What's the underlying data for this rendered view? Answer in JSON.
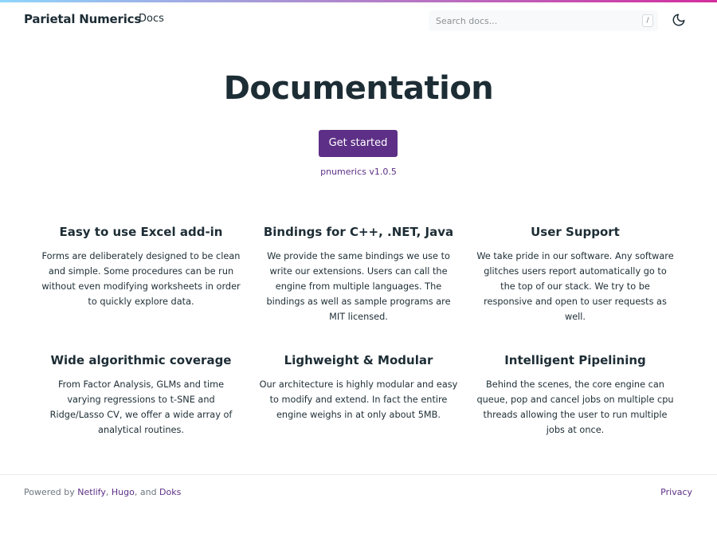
{
  "header": {
    "brand": "Parietal Numerics",
    "nav_link": "Docs",
    "search_placeholder": "Search docs...",
    "search_shortcut": "/",
    "mode_icon": "moon-icon"
  },
  "hero": {
    "title": "Documentation",
    "cta_label": "Get started",
    "version": "pnumerics v1.0.5"
  },
  "features": [
    {
      "title": "Easy to use Excel add-in",
      "text": "Forms are deliberately designed to be clean and simple. Some procedures can be run without even modifying worksheets in order to quickly explore data."
    },
    {
      "title": "Bindings for C++, .NET, Java",
      "text": "We provide the same bindings we use to write our extensions. Users can call the engine from multiple languages. The bindings as well as sample programs are MIT licensed."
    },
    {
      "title": "User Support",
      "text": "We take pride in our software. Any software glitches users report automatically go to the top of our stack. We try to be responsive and open to user requests as well."
    },
    {
      "title": "Wide algorithmic coverage",
      "text": "From Factor Analysis, GLMs and time varying regressions to t-SNE and Ridge/Lasso CV, we offer a wide array of analytical routines."
    },
    {
      "title": "Lighweight & Modular",
      "text": "Our architecture is highly modular and easy to modify and extend. In fact the entire engine weighs in at only about 5MB."
    },
    {
      "title": "Intelligent Pipelining",
      "text": "Behind the scenes, the core engine can queue, pop and cancel jobs on multiple cpu threads allowing the user to run multiple jobs at once."
    }
  ],
  "footer": {
    "powered_prefix": "Powered by ",
    "link1": "Netlify",
    "sep1": ", ",
    "link2": "Hugo",
    "sep2": ", and ",
    "link3": "Doks",
    "privacy": "Privacy"
  },
  "colors": {
    "accent": "#5d2f86",
    "text": "#1d2d35",
    "gradient_start": "#8ed6fb",
    "gradient_end": "#d32e9d"
  }
}
